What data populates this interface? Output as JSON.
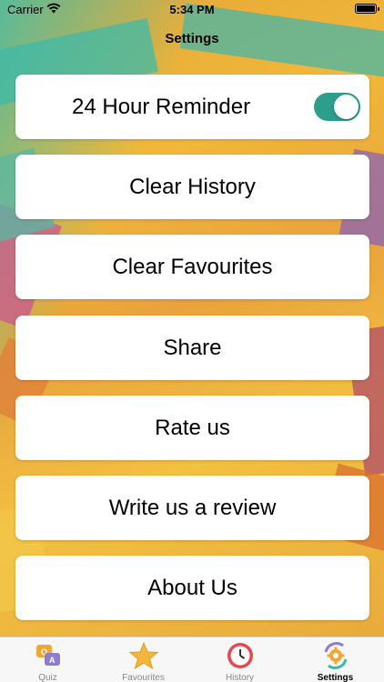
{
  "status_bar": {
    "carrier": "Carrier",
    "time": "5:34 PM"
  },
  "nav": {
    "title": "Settings"
  },
  "settings": {
    "reminder": {
      "label": "24 Hour Reminder",
      "enabled": true
    },
    "clear_history": "Clear History",
    "clear_favourites": "Clear Favourites",
    "share": "Share",
    "rate_us": "Rate us",
    "write_review": "Write us a review",
    "about_us": "About Us"
  },
  "tabs": [
    {
      "label": "Quiz",
      "icon": "quiz-icon",
      "active": false
    },
    {
      "label": "Favourites",
      "icon": "star-icon",
      "active": false
    },
    {
      "label": "History",
      "icon": "clock-icon",
      "active": false
    },
    {
      "label": "Settings",
      "icon": "gear-icon",
      "active": true
    }
  ],
  "colors": {
    "toggle_on": "#2e9e8c",
    "tab_active": "#000000"
  }
}
